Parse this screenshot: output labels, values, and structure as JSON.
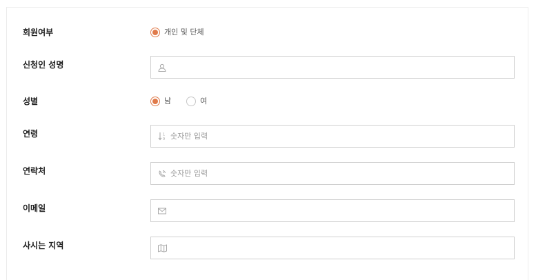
{
  "form": {
    "membership": {
      "label": "회원여부",
      "options": [
        {
          "label": "개인 및 단체",
          "checked": true
        }
      ]
    },
    "applicant_name": {
      "label": "신청인 성명",
      "value": "",
      "placeholder": "",
      "icon": "user-icon"
    },
    "gender": {
      "label": "성별",
      "options": [
        {
          "label": "남",
          "checked": true
        },
        {
          "label": "여",
          "checked": false
        }
      ]
    },
    "age": {
      "label": "연령",
      "value": "",
      "placeholder": "숫자만 입력",
      "icon": "sort-numeric-icon"
    },
    "phone": {
      "label": "연락처",
      "value": "",
      "placeholder": "숫자만 입력",
      "icon": "phone-icon"
    },
    "email": {
      "label": "이메일",
      "value": "",
      "placeholder": "",
      "icon": "envelope-icon"
    },
    "region": {
      "label": "사시는 지역",
      "value": "",
      "placeholder": "",
      "icon": "map-icon"
    }
  },
  "colors": {
    "accent": "#e07a4a",
    "border": "#cfcfcf",
    "placeholder": "#9a9a9a"
  }
}
